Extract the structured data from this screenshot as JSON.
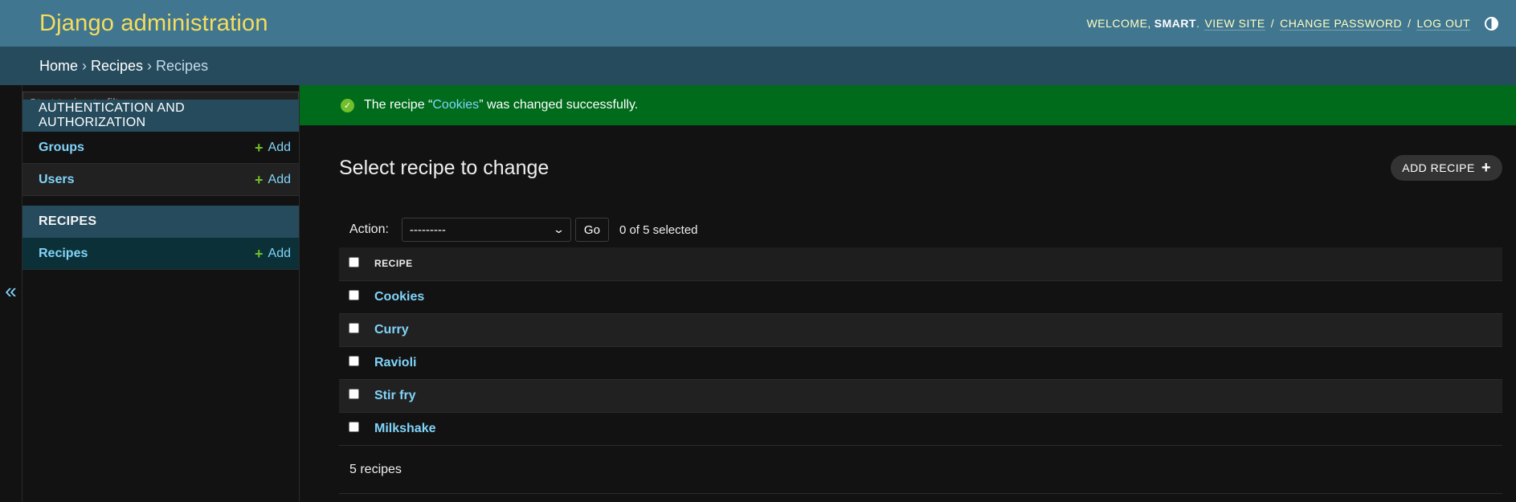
{
  "header": {
    "site_name": "Django administration",
    "welcome_label": "Welcome,",
    "username": "smart",
    "view_site": "View site",
    "change_password": "Change password",
    "log_out": "Log out",
    "theme_toggle_icon": "contrast-icon"
  },
  "breadcrumbs": {
    "home": "Home",
    "app": "Recipes",
    "current": "Recipes",
    "separator": "›"
  },
  "sidebar": {
    "toggle_icon": "«",
    "filter_placeholder": "Start typing to filter...",
    "modules": [
      {
        "caption": "Authentication and Authorization",
        "models": [
          {
            "name": "Groups",
            "add_label": "Add"
          },
          {
            "name": "Users",
            "add_label": "Add"
          }
        ]
      },
      {
        "caption": "Recipes",
        "models": [
          {
            "name": "Recipes",
            "add_label": "Add",
            "current": true
          }
        ]
      }
    ]
  },
  "message": {
    "prefix": "The recipe “",
    "link_text": "Cookies",
    "suffix": "” was changed successfully.",
    "icon": "success-check-icon"
  },
  "main": {
    "title": "Select recipe to change",
    "add_button": "Add recipe",
    "action_label": "Action:",
    "action_selected": "---------",
    "go_button": "Go",
    "selection_counter": "0 of 5 selected",
    "column_header": "Recipe",
    "rows": [
      "Cookies",
      "Curry",
      "Ravioli",
      "Stir fry",
      "Milkshake"
    ],
    "paginator": "5 recipes"
  },
  "colors": {
    "header_bg": "#417690",
    "site_name": "#f5dd5d",
    "breadcrumbs_bg": "#264b5d",
    "success_bg": "#006b1b",
    "link": "#81d4fa",
    "add_plus": "#70bf2b"
  }
}
